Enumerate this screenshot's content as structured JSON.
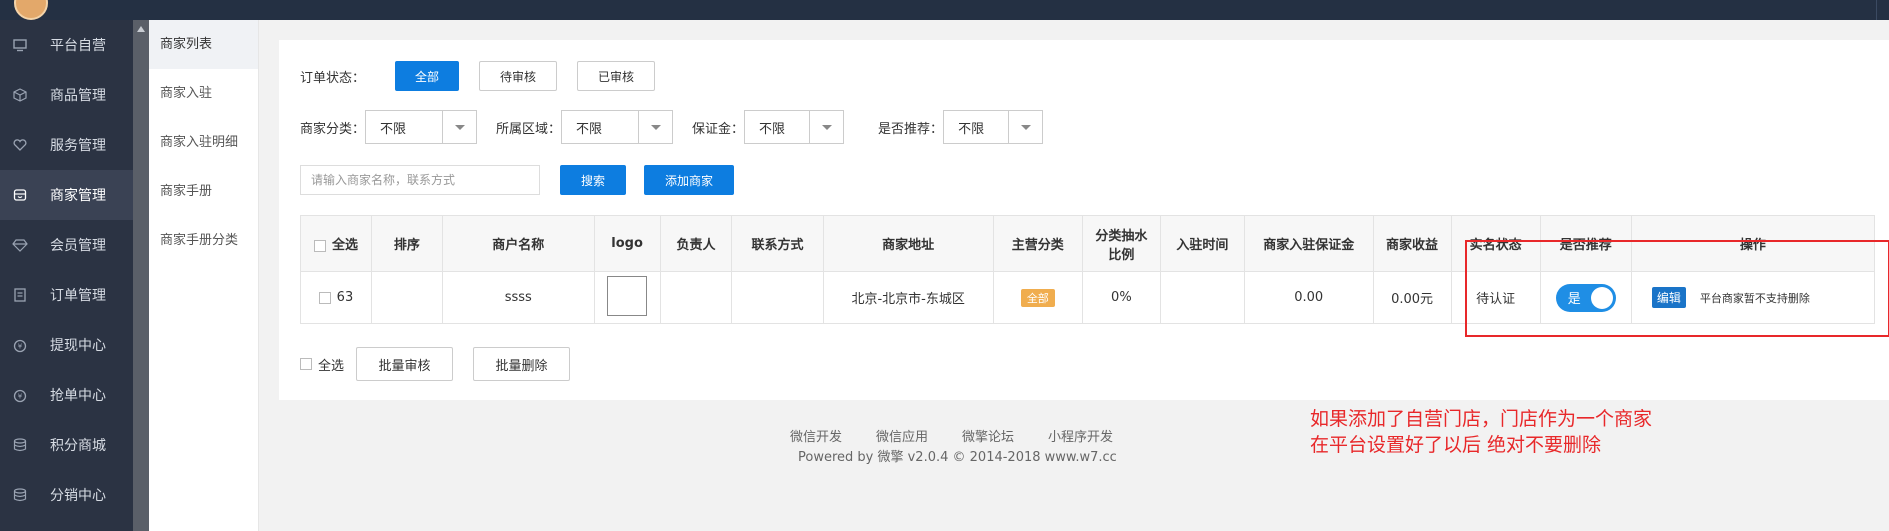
{
  "sidebar": {
    "items": [
      {
        "label": "平台自营",
        "icon": "monitor-icon",
        "active": false
      },
      {
        "label": "商品管理",
        "icon": "cube-icon",
        "active": false
      },
      {
        "label": "服务管理",
        "icon": "heart-icon",
        "active": false
      },
      {
        "label": "商家管理",
        "icon": "store-icon",
        "active": true
      },
      {
        "label": "会员管理",
        "icon": "diamond-icon",
        "active": false
      },
      {
        "label": "订单管理",
        "icon": "list-icon",
        "active": false
      },
      {
        "label": "提现中心",
        "icon": "money-icon",
        "active": false
      },
      {
        "label": "抢单中心",
        "icon": "money-icon",
        "active": false
      },
      {
        "label": "积分商城",
        "icon": "database-icon",
        "active": false
      },
      {
        "label": "分销中心",
        "icon": "database-icon",
        "active": false
      }
    ]
  },
  "submenu": {
    "items": [
      {
        "label": "商家列表",
        "active": true
      },
      {
        "label": "商家入驻",
        "active": false
      },
      {
        "label": "商家入驻明细",
        "active": false
      },
      {
        "label": "商家手册",
        "active": false
      },
      {
        "label": "商家手册分类",
        "active": false
      }
    ]
  },
  "filters": {
    "order_status_label": "订单状态：",
    "status_all": "全部",
    "status_pending": "待审核",
    "status_reviewed": "已审核",
    "category_label": "商家分类：",
    "category_value": "不限",
    "region_label": "所属区域：",
    "region_value": "不限",
    "deposit_label": "保证金：",
    "deposit_value": "不限",
    "recommend_label": "是否推荐：",
    "recommend_value": "不限",
    "search_placeholder": "请输入商家名称，联系方式",
    "search_button": "搜索",
    "add_button": "添加商家"
  },
  "table": {
    "headers": {
      "select_all": "全选",
      "sort": "排序",
      "name": "商户名称",
      "logo": "logo",
      "owner": "负责人",
      "contact": "联系方式",
      "address": "商家地址",
      "main_category": "主营分类",
      "commission_1": "分类抽水",
      "commission_2": "比例",
      "join_time": "入驻时间",
      "deposit": "商家入驻保证金",
      "income": "商家收益",
      "verify": "实名状态",
      "recommend": "是否推荐",
      "actions": "操作"
    },
    "rows": [
      {
        "sort": "63",
        "name": "ssss",
        "owner": "",
        "contact": "",
        "address": "北京-北京市-东城区",
        "category_tag": "全部",
        "commission": "0%",
        "join_time": "",
        "deposit": "0.00",
        "income": "0.00元",
        "verify": "待认证",
        "recommend_label": "是",
        "recommend_on": true,
        "edit": "编辑",
        "note": "平台商家暂不支持删除"
      }
    ]
  },
  "bulk": {
    "select_all": "全选",
    "batch_review": "批量审核",
    "batch_delete": "批量删除"
  },
  "footer": {
    "links": [
      "微信开发",
      "微信应用",
      "微擎论坛",
      "小程序开发"
    ],
    "powered": "Powered by 微擎 v2.0.4 © 2014-2018 www.w7.cc"
  },
  "annotation": {
    "line1": "如果添加了自营门店，门店作为一个商家",
    "line2": "在平台设置好了以后 绝对不要删除"
  },
  "colors": {
    "primary": "#0d7de0",
    "sidebar_bg": "#2b3343",
    "annotation_red": "#e8282a",
    "tag_orange": "#f0ad4e"
  }
}
